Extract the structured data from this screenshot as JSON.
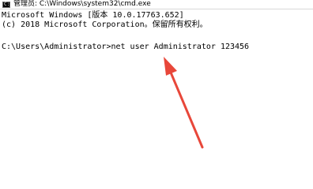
{
  "window": {
    "title": "管理员: C:\\Windows\\system32\\cmd.exe",
    "icon": "cmd-icon"
  },
  "console": {
    "lines": [
      "Microsoft Windows [版本 10.0.17763.652]",
      "(c) 2018 Microsoft Corporation。保留所有权利。",
      "",
      "C:\\Users\\Administrator>net user Administrator 123456"
    ]
  },
  "annotation": {
    "type": "arrow",
    "color": "#e8473a"
  }
}
